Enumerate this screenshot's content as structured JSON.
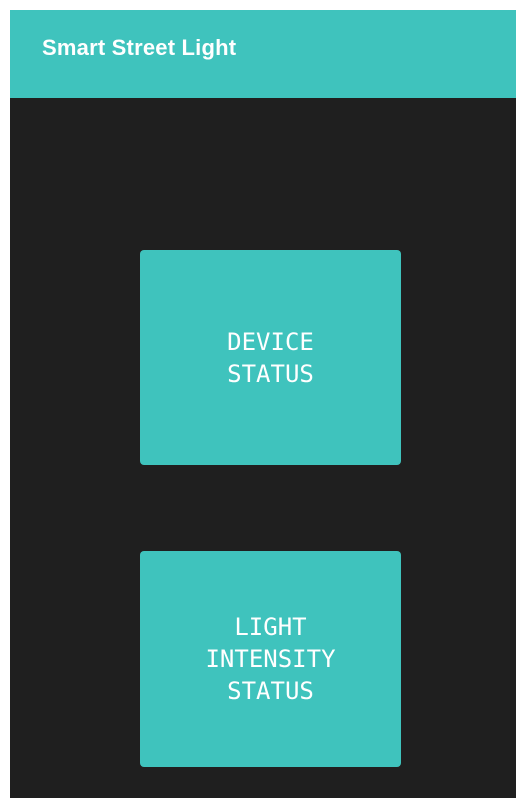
{
  "app_bar": {
    "title": "Smart Street Light"
  },
  "buttons": {
    "device_status": "DEVICE\nSTATUS",
    "light_intensity_status": "LIGHT\nINTENSITY\nSTATUS"
  },
  "colors": {
    "accent": "#3fc3bd",
    "background": "#1f1f1f",
    "text": "#ffffff"
  }
}
